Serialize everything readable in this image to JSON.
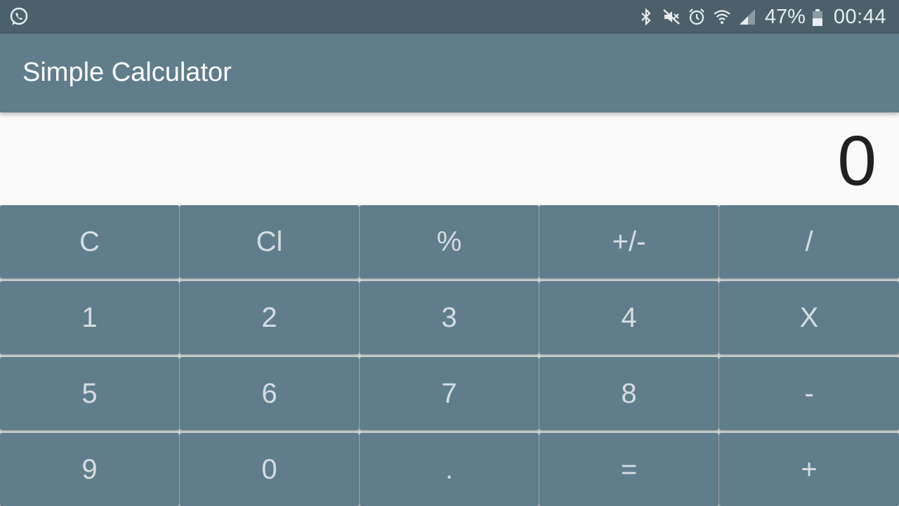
{
  "status_bar": {
    "battery": "47%",
    "time": "00:44",
    "icons": [
      "whatsapp-icon",
      "bluetooth-icon",
      "mute-icon",
      "alarm-icon",
      "wifi-icon",
      "signal-icon",
      "battery-icon"
    ]
  },
  "app_bar": {
    "title": "Simple Calculator"
  },
  "display": {
    "value": "0"
  },
  "keypad": {
    "rows": [
      [
        "C",
        "Cl",
        "%",
        "+/-",
        "/"
      ],
      [
        "1",
        "2",
        "3",
        "4",
        "X"
      ],
      [
        "5",
        "6",
        "7",
        "8",
        "-"
      ],
      [
        "9",
        "0",
        ".",
        "=",
        "+"
      ]
    ]
  },
  "colors": {
    "status_bar": "#4b606b",
    "primary": "#607d8b",
    "key_text": "#d6dde0",
    "display_bg": "#fafafa"
  }
}
